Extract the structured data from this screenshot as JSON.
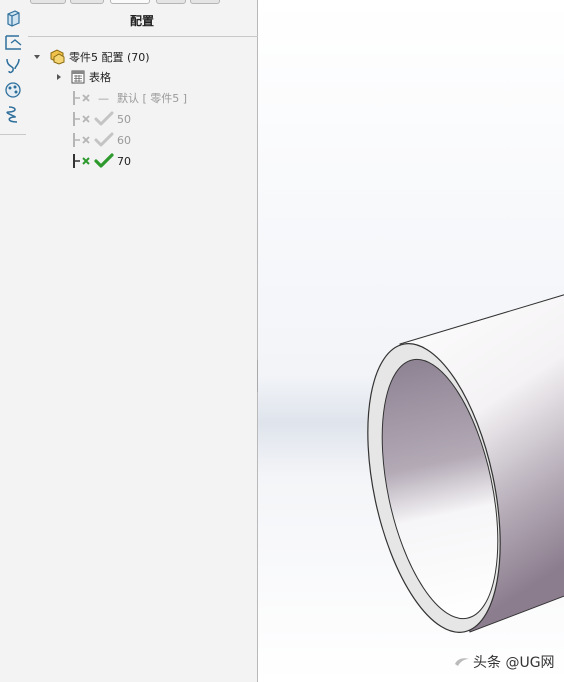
{
  "panel": {
    "title": "配置",
    "side_icons": [
      "part-icon",
      "sketch-icon",
      "curve-icon",
      "appearance-icon",
      "spring-icon"
    ],
    "tabs": [
      "feature-manager-tab",
      "property-manager-tab",
      "configuration-manager-tab",
      "dimxpert-tab",
      "display-manager-tab"
    ]
  },
  "tree": {
    "root_label": "零件5 配置 (70)",
    "table_label": "表格",
    "configs": [
      {
        "dash": "—",
        "label": "默认 [ 零件5 ]",
        "active": false
      },
      {
        "label": "50",
        "active": false
      },
      {
        "label": "60",
        "active": false
      },
      {
        "label": "70",
        "active": true
      }
    ]
  },
  "watermark": {
    "text": "头条 @UG网"
  },
  "colors": {
    "panel_bg": "#f3f3f3",
    "active_check": "#2e9a2e",
    "inactive_check": "#c4c4c4",
    "inactive_text": "#9a9a9a",
    "tube_shadow": "#8c7d8e"
  }
}
